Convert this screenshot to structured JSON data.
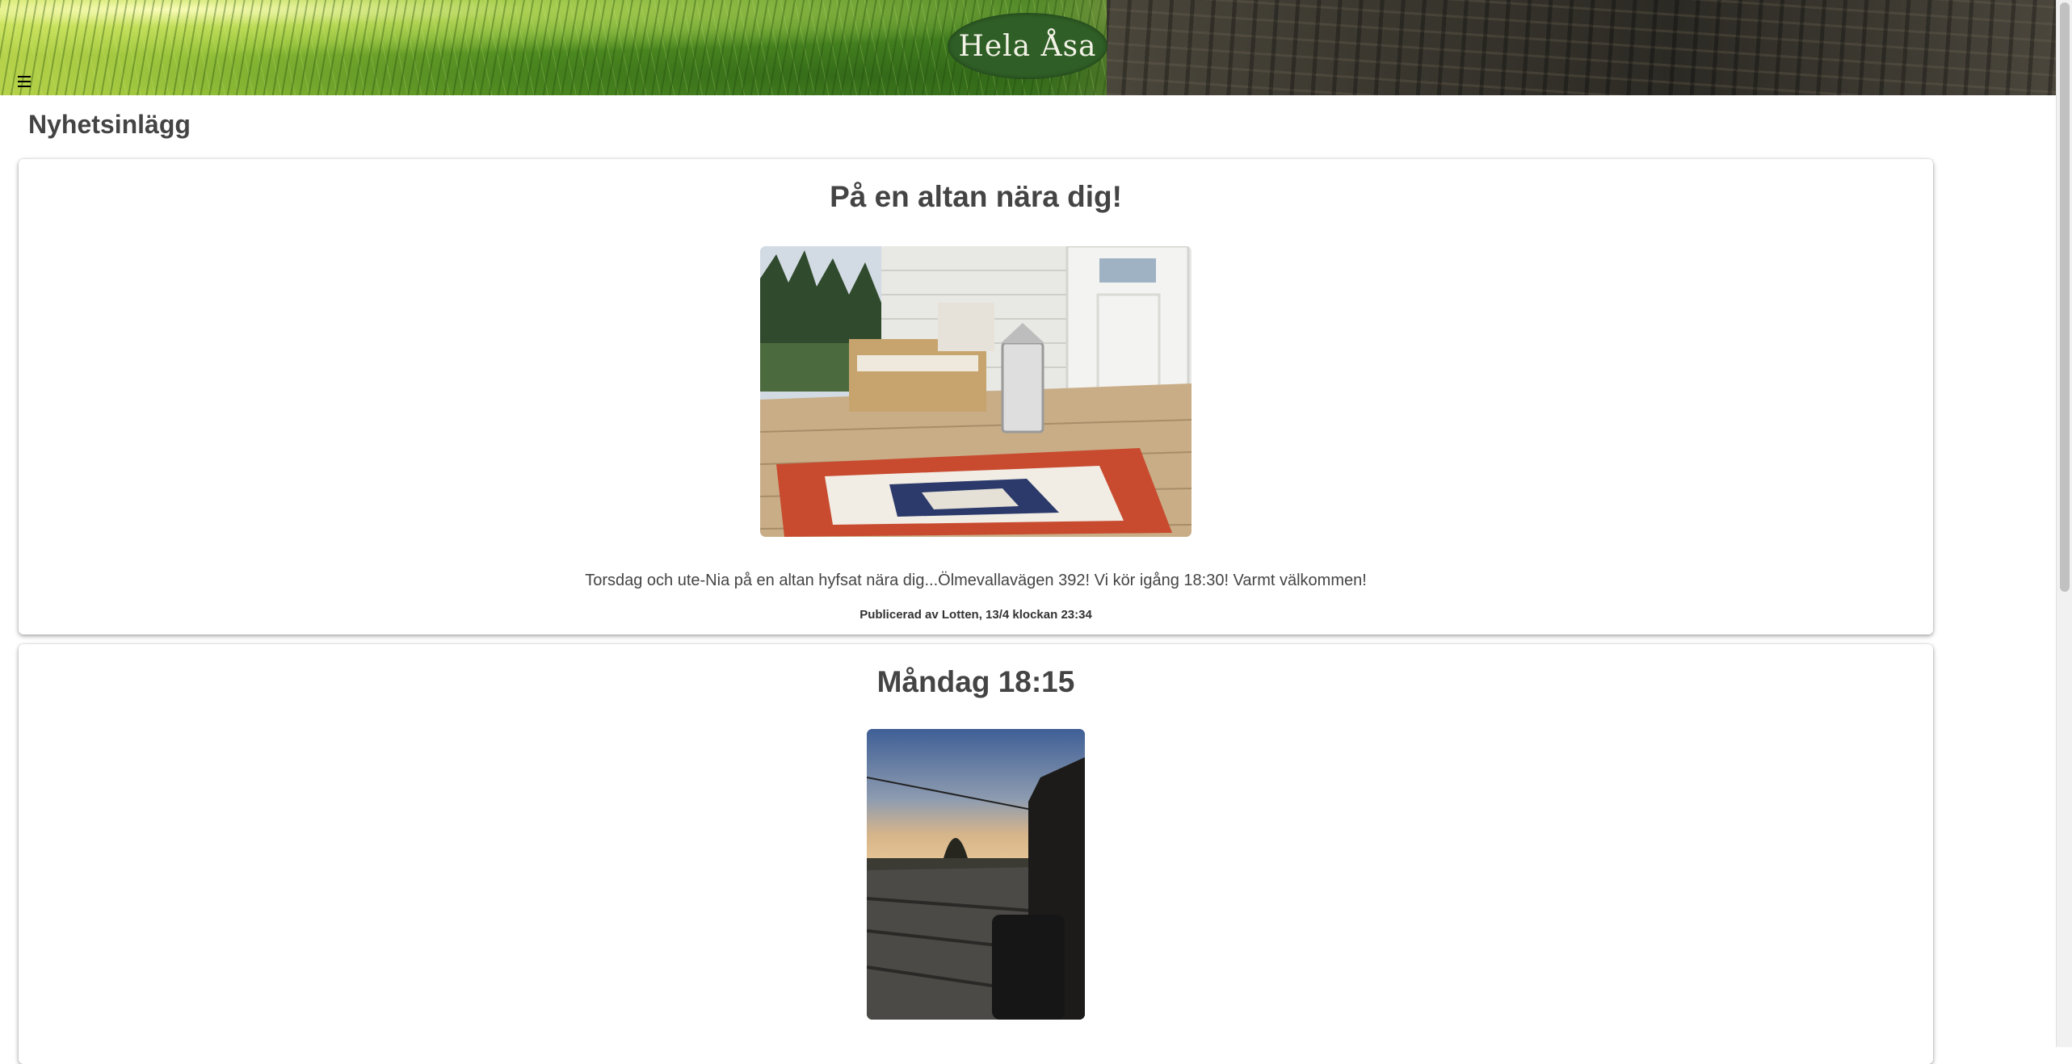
{
  "header": {
    "logo_text": "Hela Åsa",
    "menu_icon": "hamburger-menu-icon"
  },
  "page": {
    "title": "Nyhetsinlägg"
  },
  "posts": [
    {
      "title": "På en altan nära dig!",
      "image": "porch-with-rug-and-lantern-photo",
      "text": "Torsdag och ute-Nia på en altan hyfsat nära dig...Ölmevallavägen 392! Vi kör igång 18:30! Varmt välkommen!",
      "meta": "Publicerad av Lotten, 13/4 klockan 23:34"
    },
    {
      "title": "Måndag 18:15",
      "image": "sunset-over-deck-photo"
    }
  ],
  "colors": {
    "text": "#444444",
    "logo_bg": "#2f5e26"
  }
}
